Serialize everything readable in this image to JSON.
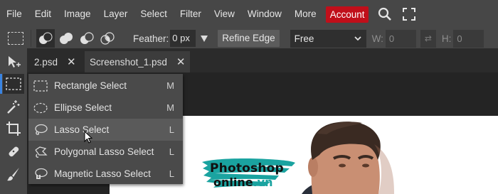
{
  "menubar": {
    "items": [
      "File",
      "Edit",
      "Image",
      "Layer",
      "Select",
      "Filter",
      "View",
      "Window",
      "More"
    ],
    "account_label": "Account",
    "icons": [
      "search-icon",
      "fullscreen-icon"
    ]
  },
  "options": {
    "feather_label": "Feather:",
    "feather_value": "0 px",
    "refine_edge_label": "Refine Edge",
    "style_value": "Free",
    "width_label": "W:",
    "width_value": "0",
    "height_label": "H:",
    "height_value": "0"
  },
  "tabs": [
    {
      "label": "2.psd",
      "active": false
    },
    {
      "label": "Screenshot_1.psd",
      "active": true
    }
  ],
  "flyout": {
    "items": [
      {
        "label": "Rectangle Select",
        "shortcut": "M",
        "icon": "rectangle-select-icon"
      },
      {
        "label": "Ellipse Select",
        "shortcut": "M",
        "icon": "ellipse-select-icon"
      },
      {
        "label": "Lasso Select",
        "shortcut": "L",
        "icon": "lasso-icon"
      },
      {
        "label": "Polygonal Lasso Select",
        "shortcut": "L",
        "icon": "polygonal-lasso-icon"
      },
      {
        "label": "Magnetic Lasso Select",
        "shortcut": "L",
        "icon": "magnetic-lasso-icon"
      }
    ]
  },
  "watermark": {
    "line1": "Photoshop",
    "line2": "online",
    "line2_suffix": ".vn"
  },
  "colors": {
    "account": "#c00f1a",
    "accent": "#3a84e2",
    "watermark_brush": "#1aa3a0"
  }
}
